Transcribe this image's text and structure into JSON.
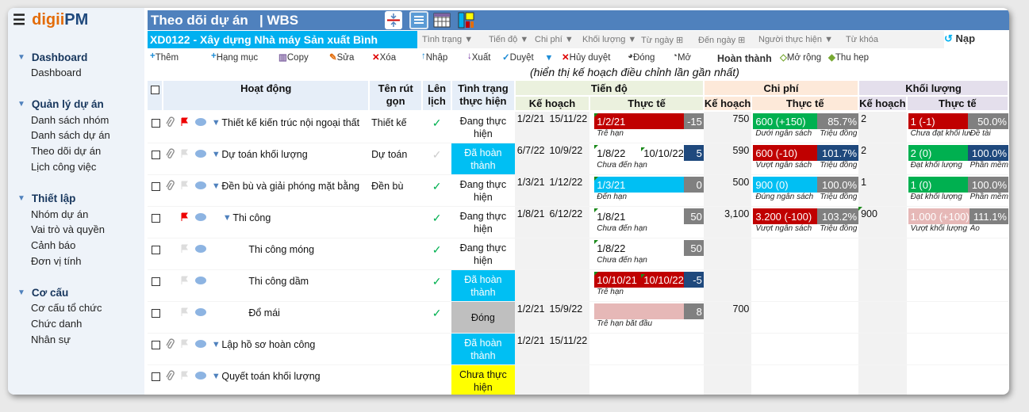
{
  "app": {
    "logo_a": "digii",
    "logo_b": "PM",
    "menu_icon": "hamburger-icon"
  },
  "sidebar": {
    "groups": [
      {
        "title": "Dashboard",
        "items": [
          "Dashboard"
        ]
      },
      {
        "title": "Quản lý dự án",
        "items": [
          "Danh sách nhóm",
          "Danh sách dự án",
          "Theo dõi dự án",
          "Lịch công việc"
        ]
      },
      {
        "title": "Thiết lập",
        "items": [
          "Nhóm dự án",
          "Vai trò và quyền",
          "Cảnh báo",
          "Đơn vị tính"
        ]
      },
      {
        "title": "Cơ cấu",
        "items": [
          "Cơ cấu tổ chức",
          "Chức danh",
          "Nhân sự"
        ]
      }
    ]
  },
  "header": {
    "title": "Theo dõi dự án   | WBS",
    "view_icons": [
      "collapse-rows-icon",
      "list-view-icon",
      "grid-view-icon",
      "board-view-icon"
    ],
    "active_view": "list-view-icon"
  },
  "project": "XD0122 - Xây dựng Nhà máy Sản xuất Bình Dương",
  "filters": [
    "Tình trạng ▼",
    "Tiến độ ▼",
    "Chi phí ▼",
    "Khối lượng ▼",
    "Từ ngày ⊞",
    "Đến ngày ⊞",
    "Người thực hiện ▼",
    "Từ khóa"
  ],
  "reload": "Nạp",
  "toolbar": [
    {
      "icon": "+",
      "label": "Thêm",
      "color": "#1f8dd6"
    },
    {
      "icon": "+",
      "label": "Hạng mục",
      "color": "#1f8dd6"
    },
    {
      "icon": "▥",
      "label": "Copy",
      "color": "#8064a2"
    },
    {
      "icon": "✎",
      "label": "Sửa",
      "color": "#e36c0a"
    },
    {
      "icon": "✕",
      "label": "Xóa",
      "color": "#d00"
    },
    {
      "icon": "↑",
      "label": "Nhập",
      "color": "#1f8dd6"
    },
    {
      "icon": "↓",
      "label": "Xuất",
      "color": "#7030a0"
    },
    {
      "icon": "✓",
      "label": "Duyệt",
      "color": "#1f8dd6"
    },
    {
      "icon": "▾",
      "label": "",
      "color": "#1f8dd6"
    },
    {
      "icon": "✕",
      "label": "Hủy duyệt",
      "color": "#d00"
    },
    {
      "icon": "◕",
      "label": "Đóng",
      "color": "#444"
    },
    {
      "icon": "◔",
      "label": "Mở",
      "color": "#444"
    },
    {
      "icon": "",
      "label": "Hoàn thành",
      "color": "#333"
    },
    {
      "icon": "◇",
      "label": "Mở rộng",
      "color": "#77a832"
    },
    {
      "icon": "◆",
      "label": "Thu hẹp",
      "color": "#77a832"
    }
  ],
  "caption": "(hiển thị kế hoạch điều chỉnh lần gần nhất)",
  "columns": {
    "activity": "Hoạt động",
    "short": "Tên rút gọn",
    "sched": "Lên lịch",
    "status": "Tình trạng thực hiện",
    "progress": "Tiến độ",
    "cost": "Chi phí",
    "volume": "Khối lượng",
    "plan": "Kế hoạch",
    "actual": "Thực tế"
  },
  "colors": {
    "red": "#c00000",
    "green": "#00b050",
    "cyan": "#00bff3",
    "navy": "#1f497d",
    "gray": "#808080",
    "pink": "#e6b8b7",
    "yellow": "#ffff00",
    "closed": "#bfbfbf"
  },
  "rows": [
    {
      "name": "Thiết kế kiến trúc nội ngoại thất",
      "short": "Thiết kế",
      "indent": 0,
      "attach": true,
      "flag": "red",
      "caret": true,
      "sched": "green",
      "status": "Đang thực hiện",
      "status_color": "",
      "plan_start": "1/2/21",
      "plan_end": "15/11/22",
      "act_start": "1/2/21",
      "act_end": "",
      "act_color": "red",
      "act_num": "-15",
      "act_num_color": "gray",
      "act_label": "Trễ hạn",
      "cost_plan": "750",
      "cost_act": "600 (+150)",
      "cost_color": "green",
      "cost_pct": "85.7%",
      "cost_pct_color": "gray",
      "cost_label": "Dưới ngân sách",
      "cost_unit": "Triệu đồng",
      "vol_plan": "2",
      "vol_act": "1 (-1)",
      "vol_color": "red",
      "vol_pct": "50.0%",
      "vol_pct_color": "gray",
      "vol_label": "Chưa đạt khối lượng",
      "vol_unit": "Đề tài"
    },
    {
      "name": "Dự toán khối lượng",
      "short": "Dự toán",
      "indent": 0,
      "attach": true,
      "flag": "gray",
      "caret": true,
      "sched": "light",
      "status": "Đã hoàn thành",
      "status_color": "cyan",
      "plan_start": "6/7/22",
      "plan_end": "10/9/22",
      "act_start": "1/8/22",
      "act_end": "10/10/22",
      "act_color": "",
      "act_num": "5",
      "act_num_color": "navy",
      "act_label": "Chưa đến hạn",
      "cost_plan": "590",
      "cost_act": "600 (-10)",
      "cost_color": "red",
      "cost_pct": "101.7%",
      "cost_pct_color": "navy",
      "cost_label": "Vượt ngân sách",
      "cost_unit": "Triệu đồng",
      "vol_plan": "2",
      "vol_act": "2 (0)",
      "vol_color": "green",
      "vol_pct": "100.0%",
      "vol_pct_color": "navy",
      "vol_label": "Đạt khối lượng",
      "vol_unit": "Phần mềm"
    },
    {
      "name": "Đền bù và giải phóng mặt bằng",
      "short": "Đền bù",
      "indent": 0,
      "attach": true,
      "flag": "gray",
      "caret": true,
      "sched": "green",
      "status": "Đang thực hiện",
      "status_color": "",
      "plan_start": "1/3/21",
      "plan_end": "1/12/22",
      "act_start": "1/3/21",
      "act_end": "",
      "act_color": "cyan",
      "act_num": "0",
      "act_num_color": "gray",
      "act_label": "Đến hạn",
      "cost_plan": "500",
      "cost_act": "900 (0)",
      "cost_color": "cyan",
      "cost_pct": "100.0%",
      "cost_pct_color": "gray",
      "cost_label": "Đúng ngân sách",
      "cost_unit": "Triệu đồng",
      "vol_plan": "1",
      "vol_act": "1 (0)",
      "vol_color": "green",
      "vol_pct": "100.0%",
      "vol_pct_color": "gray",
      "vol_label": "Đạt khối lượng",
      "vol_unit": "Phần mềm"
    },
    {
      "name": "Thi công",
      "short": "",
      "indent": 1,
      "attach": false,
      "flag": "red",
      "caret": true,
      "sched": "green",
      "status": "Đang thực hiện",
      "status_color": "",
      "plan_start": "1/8/21",
      "plan_end": "6/12/22",
      "act_start": "1/8/21",
      "act_end": "",
      "act_color": "",
      "act_num": "50",
      "act_num_color": "gray",
      "act_label": "Chưa đến hạn",
      "cost_plan": "3,100",
      "cost_act": "3.200 (-100)",
      "cost_color": "red",
      "cost_pct": "103.2%",
      "cost_pct_color": "gray",
      "cost_label": "Vượt ngân sách",
      "cost_unit": "Triệu đồng",
      "vol_plan": "900",
      "vol_act": "1.000 (+100)",
      "vol_color": "pink",
      "vol_pct": "111.1%",
      "vol_pct_color": "gray",
      "vol_label": "Vượt khối lượng",
      "vol_unit": "Ảo"
    },
    {
      "name": "Thi công móng",
      "short": "",
      "indent": 2,
      "attach": false,
      "flag": "gray",
      "caret": false,
      "sched": "green",
      "status": "Đang thực hiện",
      "status_color": "",
      "plan_start": "",
      "plan_end": "",
      "act_start": "1/8/22",
      "act_end": "",
      "act_color": "",
      "act_num": "50",
      "act_num_color": "gray",
      "act_label": "Chưa đến hạn"
    },
    {
      "name": "Thi công dầm",
      "short": "",
      "indent": 2,
      "attach": false,
      "flag": "gray",
      "caret": false,
      "sched": "green",
      "status": "Đã hoàn thành",
      "status_color": "cyan",
      "plan_start": "",
      "plan_end": "",
      "act_start": "10/10/21",
      "act_end": "10/10/22",
      "act_color": "red",
      "act_num": "-5",
      "act_num_color": "navy",
      "act_label": "Trễ hạn"
    },
    {
      "name": "Đổ mái",
      "short": "",
      "indent": 2,
      "attach": false,
      "flag": "gray",
      "caret": false,
      "sched": "green",
      "status": "Đóng",
      "status_color": "closed",
      "plan_start": "1/2/21",
      "plan_end": "15/9/22",
      "act_start": "",
      "act_end": "",
      "act_color": "pink",
      "act_num": "8",
      "act_num_color": "gray",
      "act_label": "Trễ hạn bắt đầu",
      "cost_plan": "700"
    },
    {
      "name": "Lập hồ sơ hoàn công",
      "short": "",
      "indent": 0,
      "attach": true,
      "flag": "gray",
      "caret": true,
      "sched": "",
      "status": "Đã hoàn thành",
      "status_color": "cyan",
      "plan_start": "1/2/21",
      "plan_end": "15/11/22"
    },
    {
      "name": "Quyết toán khối lượng",
      "short": "",
      "indent": 0,
      "attach": true,
      "flag": "gray",
      "caret": true,
      "sched": "",
      "status": "Chưa thực hiện",
      "status_color": "yellow"
    }
  ]
}
